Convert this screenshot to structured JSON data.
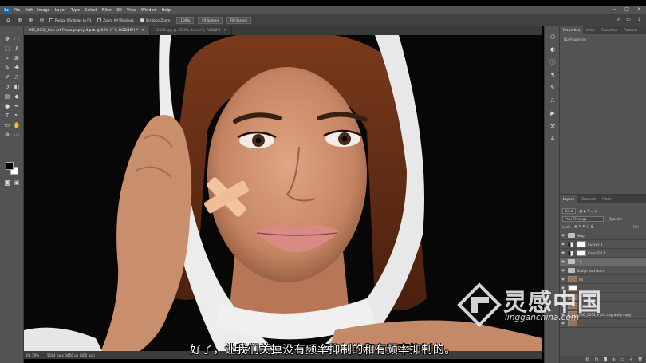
{
  "menubar": {
    "logo": "Ps",
    "items": [
      "File",
      "Edit",
      "Image",
      "Layer",
      "Type",
      "Select",
      "Filter",
      "3D",
      "View",
      "Window",
      "Help"
    ],
    "window_controls": [
      "—",
      "□",
      "✕"
    ]
  },
  "optionsbar": {
    "resize_windows": "Resize Windows to Fit",
    "zoom_all": "Zoom All Windows",
    "scrubby_zoom": "Scrubby Zoom",
    "zoom_level": "100%",
    "fit_screen": "Fit Screen",
    "fill_screen": "Fill Screen"
  },
  "tabs": [
    {
      "label": "IMG_0032_Irah Art Photography-4.psb @ 66% (F S, RGB/16*) *",
      "active": true
    },
    {
      "label": "11590.jpg @ 33.3% (Level 3, RGB/8*)",
      "active": false
    }
  ],
  "statusbar": {
    "zoom": "66.79%",
    "doc": "5184 px x 3456 px (300 ppi)"
  },
  "panels": {
    "properties_tabs": [
      "Properties",
      "Color",
      "Swatches",
      "Patterns"
    ],
    "no_properties": "No Properties",
    "layers_tabs": [
      "Layers",
      "Channels",
      "Paths"
    ],
    "filter_kind": "Kind",
    "blend_mode": "Pass Through",
    "opacity_label": "Opacity:",
    "lock_label": "Lock:",
    "fill_label": "Fill:",
    "layers": [
      {
        "name": "Help",
        "kind": "folder",
        "selected": false
      },
      {
        "name": "Curves 1",
        "kind": "adjust",
        "selected": false
      },
      {
        "name": "Color Fill 1",
        "kind": "adjust",
        "selected": false
      },
      {
        "name": "F S",
        "kind": "folder",
        "selected": true
      },
      {
        "name": "Dodge and Burn",
        "kind": "folder",
        "selected": false
      },
      {
        "name": "fix",
        "kind": "face",
        "selected": false
      },
      {
        "name": "",
        "kind": "mask",
        "selected": false
      },
      {
        "name": "",
        "kind": "face",
        "selected": false
      },
      {
        "name": "",
        "kind": "face",
        "selected": false
      },
      {
        "name": "IMG_0032_Irah...tography copy",
        "kind": "face",
        "selected": false
      },
      {
        "name": "",
        "kind": "face",
        "selected": false
      }
    ]
  },
  "subtitle": "好了，让我们关掉没有频率抑制的和有频率抑制的。",
  "watermark": {
    "cn": "灵感中国",
    "url": "lingganchina.com"
  },
  "colors": {
    "ui_bg": "#535353",
    "canvas_bg": "#0a0a0a",
    "menubar": "#535353",
    "tab_active": "#505050"
  }
}
